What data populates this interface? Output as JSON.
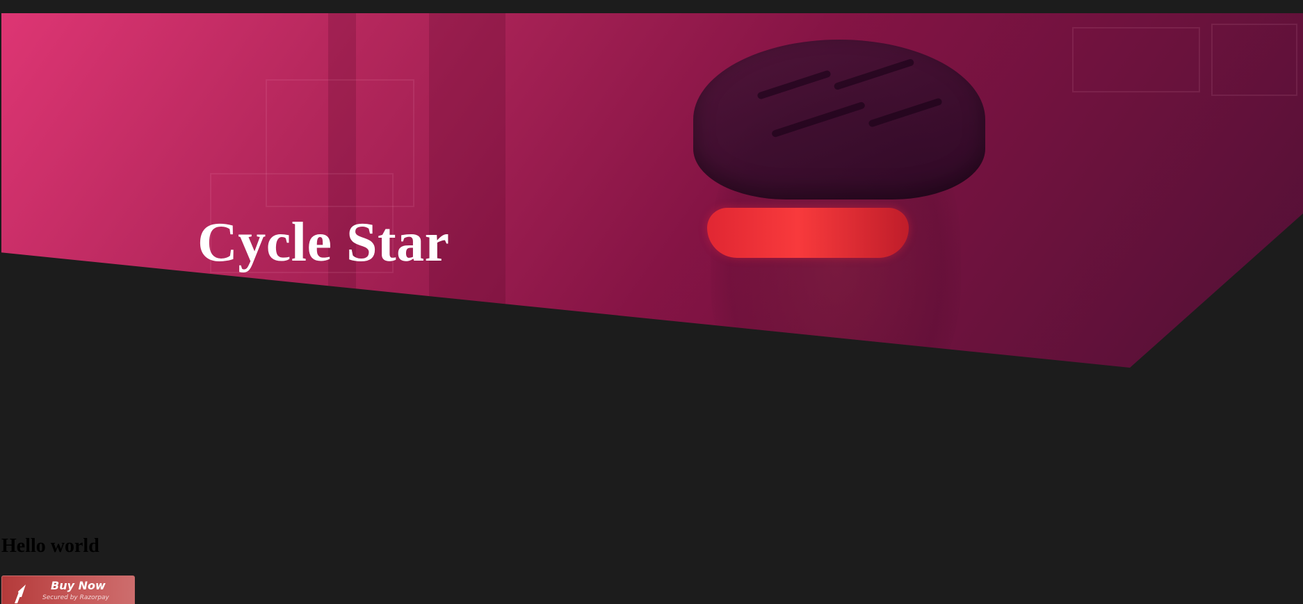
{
  "hero": {
    "title": "Cycle Star"
  },
  "content": {
    "heading": "Hello world"
  },
  "payment_button": {
    "label": "Buy Now",
    "sublabel": "Secured by Razorpay",
    "icon": "razorpay-logo-icon"
  },
  "colors": {
    "page_background": "#1c1c1c",
    "hero_gradient_start": "#e83778",
    "hero_gradient_end": "#55103a",
    "button_background": "#c75a5a"
  }
}
